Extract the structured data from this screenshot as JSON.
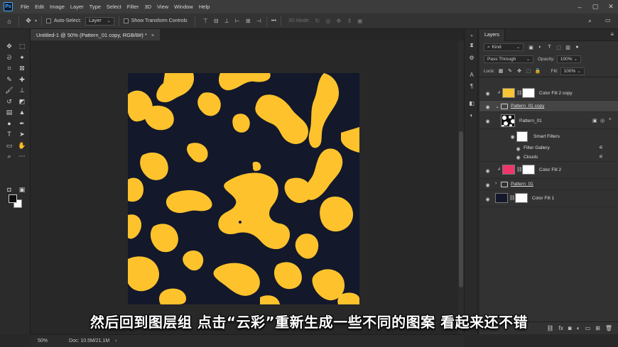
{
  "app": {
    "logo": "Ps",
    "menu": [
      "File",
      "Edit",
      "Image",
      "Layer",
      "Type",
      "Select",
      "Filter",
      "3D",
      "View",
      "Window",
      "Help"
    ],
    "accent": "#4aa8ff"
  },
  "options_bar": {
    "auto_select_label": "Auto-Select:",
    "auto_select_value": "Layer",
    "show_transform_label": "Show Transform Controls",
    "more_label": "•••",
    "mode_3d_label": "3D Mode:"
  },
  "document": {
    "tab_title": "Untitled-1 @ 50% (Pattern_01 copy, RGB/8#) *",
    "zoom": "50%",
    "doc_size": "Doc: 10.5M/21.1M",
    "colors": {
      "background": "#13182b",
      "pattern": "#fec32c"
    }
  },
  "layers_panel": {
    "title": "Layers",
    "kind_label": "Kind",
    "blend_mode": "Pass Through",
    "opacity_label": "Opacity:",
    "opacity_value": "100%",
    "lock_label": "Lock:",
    "fill_label": "Fill:",
    "fill_value": "100%",
    "layers": [
      {
        "name": "Color Fill 2 copy",
        "thumb_color": "#f7c535"
      },
      {
        "name": "Pattern_01 copy"
      },
      {
        "name": "Pattern_01"
      },
      {
        "name": "Smart Filters"
      },
      {
        "name": "Filter Gallery"
      },
      {
        "name": "Clouds"
      },
      {
        "name": "Color Fill 2",
        "thumb_color": "#f0356a"
      },
      {
        "name": "Pattern_01"
      },
      {
        "name": "Color Fill 1",
        "thumb_color": "#13182b"
      }
    ]
  },
  "subtitle": "然后回到图层组 点击“云彩”重新生成一些不同的图案 看起来还不错"
}
